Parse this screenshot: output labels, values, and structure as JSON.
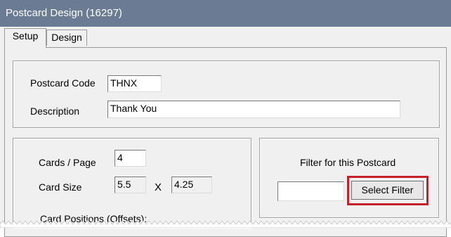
{
  "window": {
    "title": "Postcard Design (16297)"
  },
  "tabs": [
    {
      "label": "Setup",
      "active": true
    },
    {
      "label": "Design",
      "active": false
    }
  ],
  "code_section": {
    "postcard_code_label": "Postcard Code",
    "postcard_code_value": "THNX",
    "description_label": "Description",
    "description_value": "Thank You"
  },
  "layout_section": {
    "cards_per_page_label": "Cards / Page",
    "cards_per_page_value": "4",
    "card_size_label": "Card Size",
    "card_width": "5.5",
    "times_symbol": "X",
    "card_height": "4.25",
    "card_positions_label": "Card Positions (Offsets):"
  },
  "filter_section": {
    "label": "Filter for this Postcard",
    "filter_value": "",
    "select_filter_label": "Select Filter"
  },
  "colors": {
    "titlebar": "#6a7b93",
    "highlight": "#c8202a"
  }
}
